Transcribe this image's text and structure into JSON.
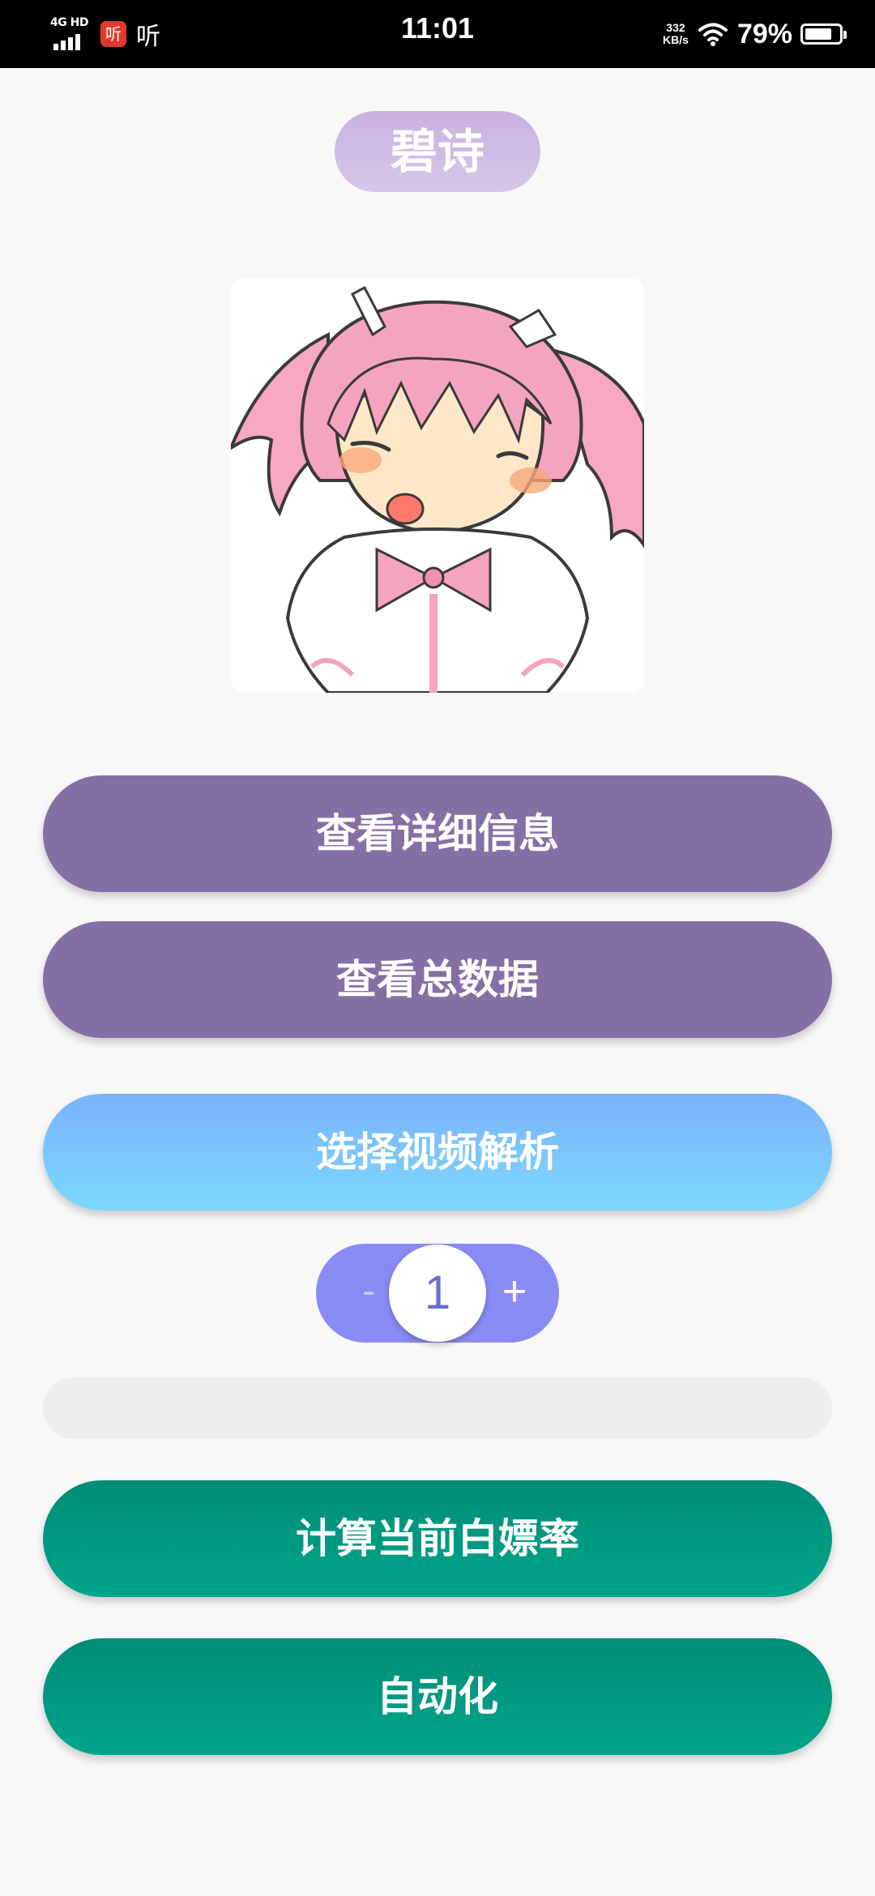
{
  "status_bar": {
    "network": "4G HD",
    "app_badge": "听",
    "app_label": "听",
    "time": "11:01",
    "net_speed_value": "332",
    "net_speed_unit": "KB/s",
    "battery_percent": "79%",
    "battery_level": 0.79
  },
  "header": {
    "title": "碧诗"
  },
  "avatar": {
    "icon": "chibi-character-image"
  },
  "buttons": {
    "details": "查看详细信息",
    "totals": "查看总数据",
    "video_parse": "选择视频解析",
    "calc_rate": "计算当前白嫖率",
    "automation": "自动化"
  },
  "stepper": {
    "minus": "-",
    "value": "1",
    "plus": "+"
  },
  "progress": {
    "value": 0
  },
  "colors": {
    "purple_button": "#8570a5",
    "blue_button": "#7ab2fb",
    "green_button": "#009a82",
    "stepper": "#8a8cf6",
    "title_pill": "#c7b2e0"
  }
}
